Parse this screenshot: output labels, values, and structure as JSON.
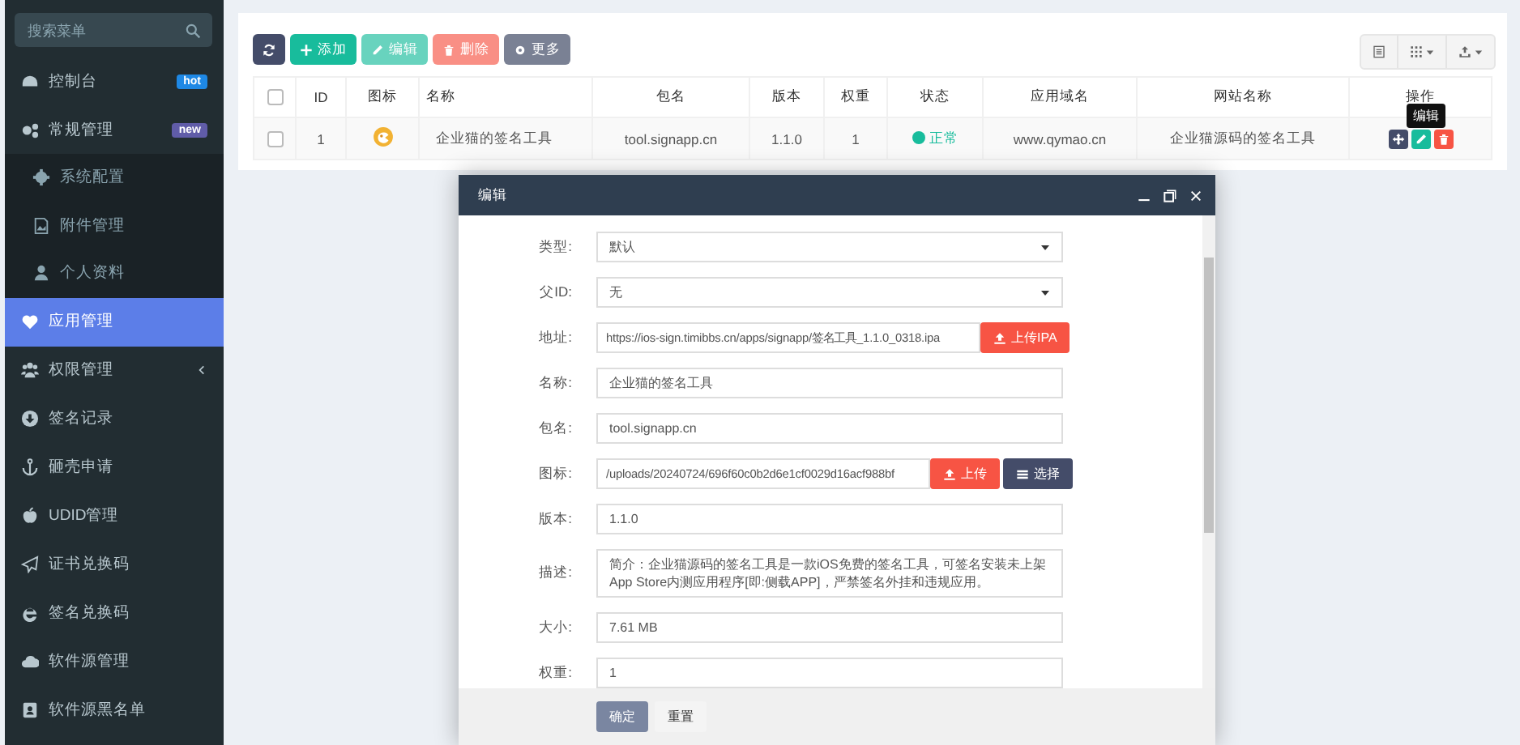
{
  "sidebar": {
    "search": {
      "placeholder": "搜索菜单"
    },
    "items": [
      {
        "label": "控制台",
        "badge": {
          "text": "hot",
          "color": "#1e88e5"
        },
        "selected": false
      },
      {
        "label": "常规管理",
        "badge": {
          "text": "new",
          "color": "#605ca8"
        },
        "selected": false,
        "expanded": true,
        "children": [
          {
            "label": "系统配置",
            "selected": false
          },
          {
            "label": "附件管理",
            "selected": false
          },
          {
            "label": "个人资料",
            "selected": false
          }
        ]
      },
      {
        "label": "应用管理",
        "selected": true
      },
      {
        "label": "权限管理",
        "selected": false,
        "expanded": false
      },
      {
        "label": "签名记录",
        "selected": false
      },
      {
        "label": "砸壳申请",
        "selected": false
      },
      {
        "label": "UDID管理",
        "selected": false
      },
      {
        "label": "证书兑换码",
        "selected": false
      },
      {
        "label": "签名兑换码",
        "selected": false
      },
      {
        "label": "软件源管理",
        "selected": false
      },
      {
        "label": "软件源黑名单",
        "selected": false
      }
    ]
  },
  "toolbar": {
    "buttons": [
      {
        "kind": "refresh",
        "disabled": false
      },
      {
        "kind": "add",
        "label": "添加",
        "disabled": false
      },
      {
        "kind": "edit",
        "label": "编辑",
        "disabled": true
      },
      {
        "kind": "delete",
        "label": "删除",
        "disabled": true
      },
      {
        "kind": "more",
        "label": "更多",
        "disabled": false
      }
    ]
  },
  "table": {
    "select_all": {
      "checked": false
    },
    "columns": [
      "ID",
      "图标",
      "名称",
      "包名",
      "版本",
      "权重",
      "状态",
      "应用域名",
      "网站名称",
      "操作"
    ],
    "rows": [
      {
        "checked": false,
        "id": "1",
        "name": "企业猫的签名工具",
        "package": "tool.signapp.cn",
        "version": "1.1.0",
        "weight": "1",
        "status": {
          "text": "正常",
          "color": "#18bc9c"
        },
        "domain": "www.qymao.cn",
        "site": "企业猫源码的签名工具"
      }
    ],
    "tooltip": "编辑"
  },
  "dialog": {
    "title": "编辑",
    "fields": [
      {
        "kind": "select",
        "label": "类型:",
        "value": "默认"
      },
      {
        "kind": "select",
        "label": "父ID:",
        "value": "无"
      },
      {
        "kind": "upload",
        "label": "地址:",
        "value": "https://ios-sign.timibbs.cn/apps/signapp/签名工具_1.1.0_0318.ipa",
        "buttons": [
          {
            "kind": "danger",
            "label": "上传IPA"
          }
        ]
      },
      {
        "kind": "text",
        "label": "名称:",
        "value": "企业猫的签名工具"
      },
      {
        "kind": "text",
        "label": "包名:",
        "value": "tool.signapp.cn"
      },
      {
        "kind": "upload",
        "label": "图标:",
        "value": "/uploads/20240724/696f60c0b2d6e1cf0029d16acf988bf",
        "buttons": [
          {
            "kind": "danger",
            "label": "上传"
          },
          {
            "kind": "dark",
            "label": "选择"
          }
        ]
      },
      {
        "kind": "text",
        "label": "版本:",
        "value": "1.1.0"
      },
      {
        "kind": "textarea",
        "label": "描述:",
        "value": "简介：企业猫源码的签名工具是一款iOS免费的签名工具，可签名安装未上架App Store内测应用程序[即:侧载APP]，严禁签名外挂和违规应用。"
      },
      {
        "kind": "text",
        "label": "大小:",
        "value": "7.61 MB"
      },
      {
        "kind": "text",
        "label": "权重:",
        "value": "1"
      }
    ],
    "footer": [
      {
        "kind": "primary",
        "label": "确定"
      },
      {
        "kind": "default",
        "label": "重置"
      }
    ]
  }
}
